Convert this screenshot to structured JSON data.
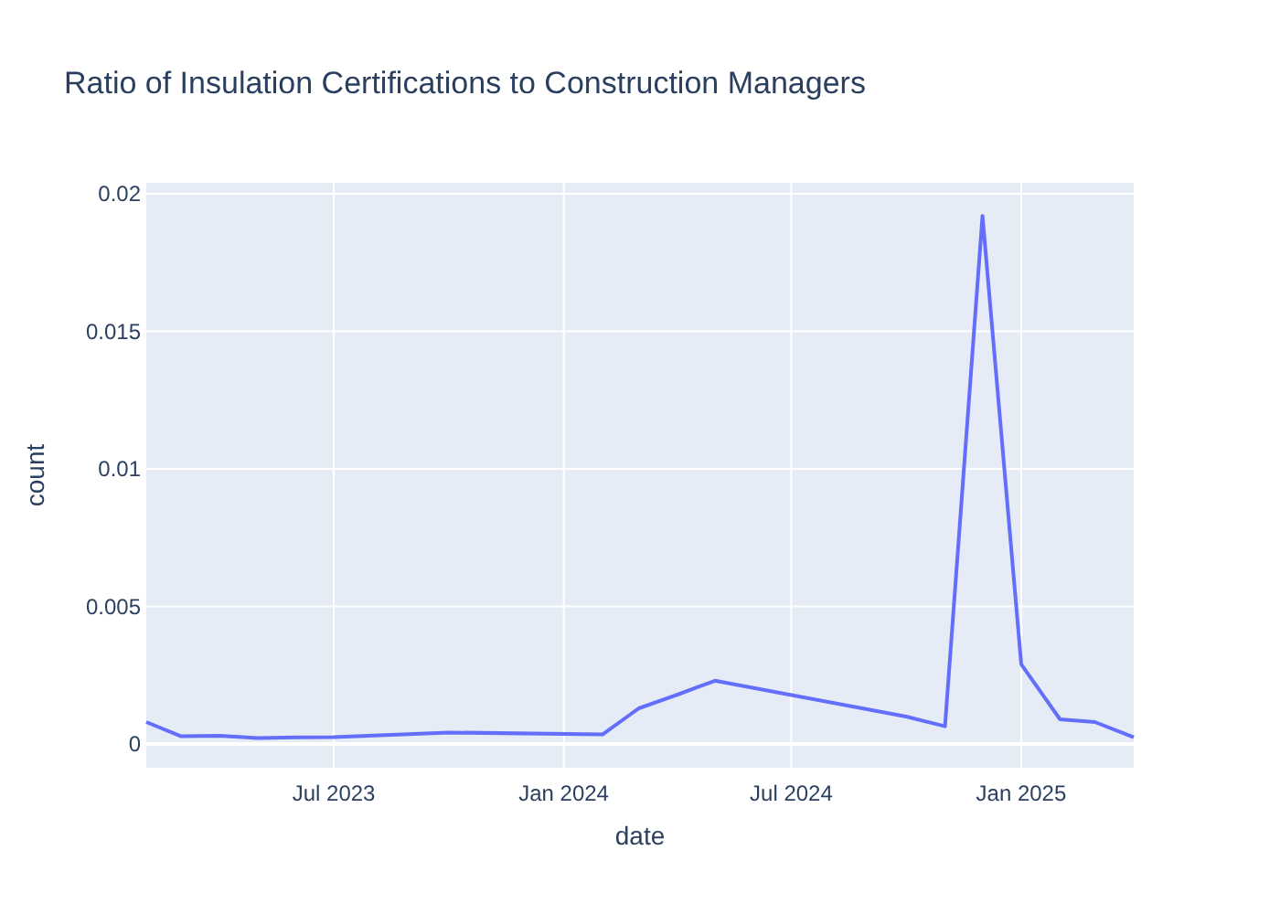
{
  "chart": {
    "chart_data": {
      "type": "line",
      "title": "Ratio of Insulation Certifications to Construction Managers",
      "xlabel": "date",
      "ylabel": "count",
      "x": [
        "2023-02-01",
        "2023-03-01",
        "2023-04-01",
        "2023-05-01",
        "2023-06-01",
        "2023-07-01",
        "2023-10-01",
        "2024-02-01",
        "2024-03-01",
        "2024-04-01",
        "2024-05-01",
        "2024-10-01",
        "2024-11-01",
        "2024-12-01",
        "2025-01-01",
        "2025-02-01",
        "2025-03-01",
        "2025-04-01"
      ],
      "series": [
        {
          "color": "#636efa",
          "values": [
            0.0008,
            0.00028,
            0.0003,
            0.00022,
            0.00024,
            0.00025,
            0.00042,
            0.00035,
            0.0013,
            0.0018,
            0.0023,
            0.001,
            0.00065,
            0.0192,
            0.0029,
            0.0009,
            0.0008,
            0.00025
          ]
        }
      ],
      "grid": true,
      "xlim": [
        "2023-02-01",
        "2025-04-01"
      ],
      "ylim": [
        -0.00086,
        0.0204
      ],
      "xticks": [
        {
          "value": "2023-07-01",
          "label": "Jul 2023"
        },
        {
          "value": "2024-01-01",
          "label": "Jan 2024"
        },
        {
          "value": "2024-07-01",
          "label": "Jul 2024"
        },
        {
          "value": "2025-01-01",
          "label": "Jan 2025"
        }
      ],
      "yticks": [
        {
          "value": 0,
          "label": "0"
        },
        {
          "value": 0.005,
          "label": "0.005"
        },
        {
          "value": 0.01,
          "label": "0.01"
        },
        {
          "value": 0.015,
          "label": "0.015"
        },
        {
          "value": 0.02,
          "label": "0.02"
        }
      ]
    }
  }
}
